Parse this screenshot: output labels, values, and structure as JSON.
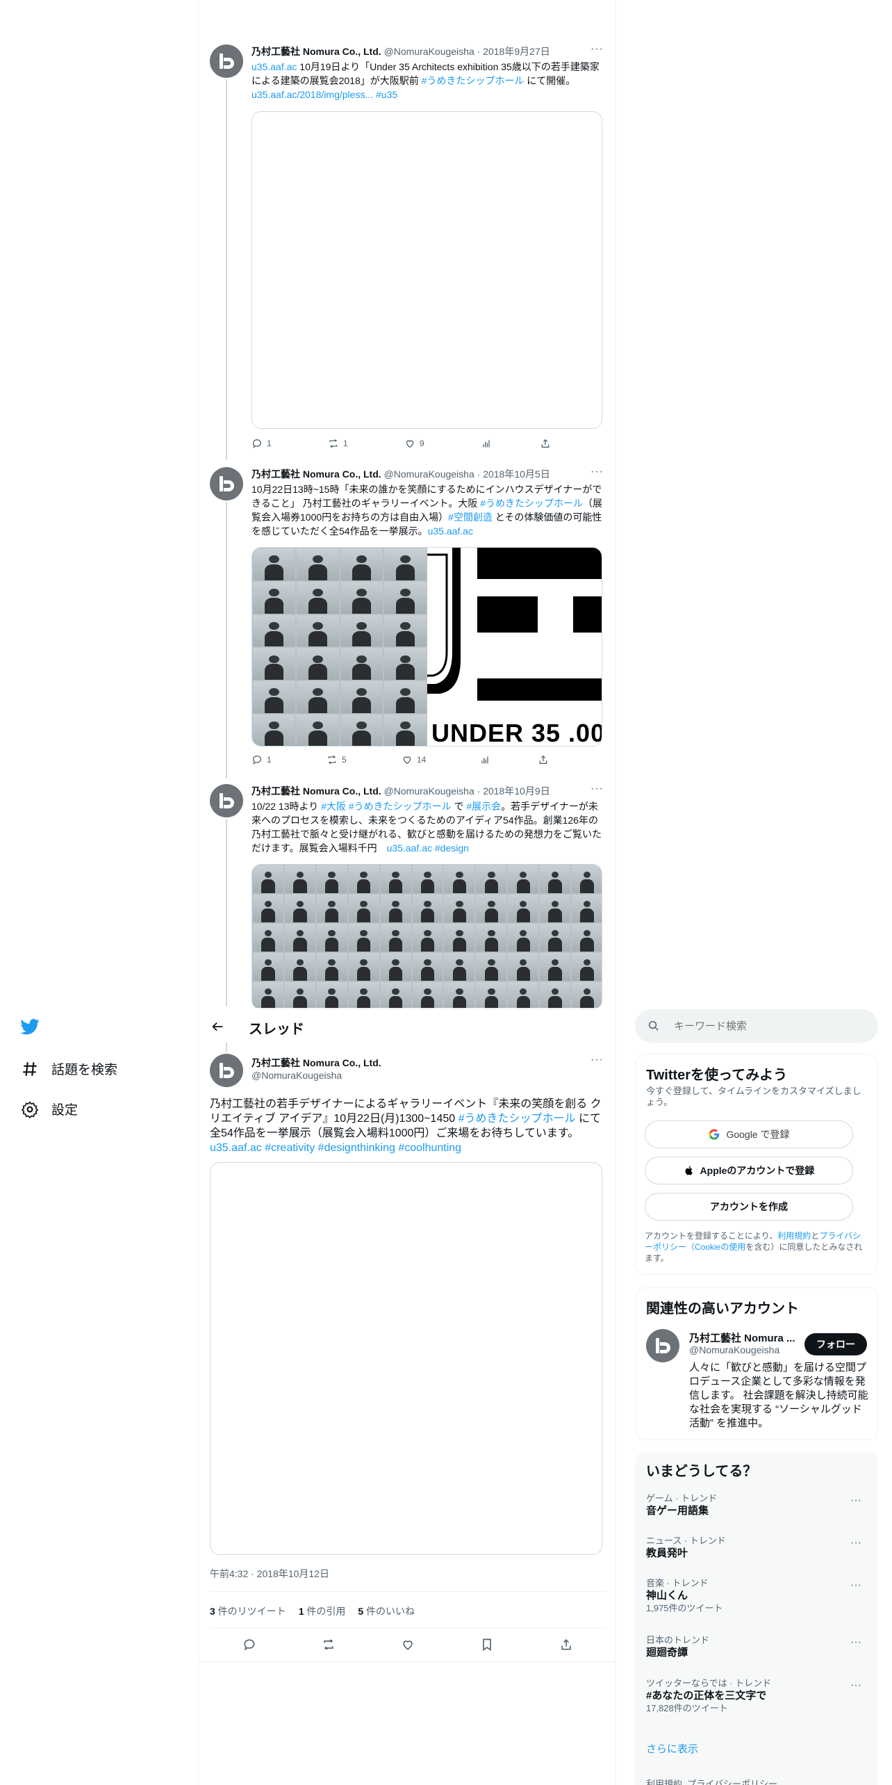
{
  "tweets": [
    {
      "name": "乃村工藝社 Nomura Co., Ltd.",
      "handle": "@NomuraKougeisha",
      "sep": "·",
      "date": "2018年9月27日",
      "more": "···",
      "text": [
        {
          "t": "u35.aaf.ac",
          "link": true
        },
        {
          "t": "  10月19日より「Under 35 Architects exhibition 35歳以下の若手建築家による建築の展覧会2018」が大阪駅前 ",
          "link": false
        },
        {
          "t": "#うめきたシップホール",
          "link": true
        },
        {
          "t": " にて開催。",
          "link": false
        },
        {
          "t": "u35.aaf.ac/2018/img/pless...",
          "link": true
        },
        {
          "t": "  ",
          "link": false
        },
        {
          "t": "#u35",
          "link": true
        }
      ],
      "replies": "1",
      "retweets": "1",
      "likes": "9"
    },
    {
      "name": "乃村工藝社 Nomura Co., Ltd.",
      "handle": "@NomuraKougeisha",
      "sep": "·",
      "date": "2018年10月5日",
      "more": "···",
      "text": [
        {
          "t": "10月22日13時~15時「未来の誰かを笑顔にするためにインハウスデザイナーができること」 乃村工藝社のギャラリーイベント。大阪 ",
          "link": false
        },
        {
          "t": "#うめきたシップホール",
          "link": true
        },
        {
          "t": "（展覧会入場券1000円をお持ちの方は自由入場）",
          "link": false
        },
        {
          "t": "#空間創造",
          "link": true
        },
        {
          "t": " とその体験価値の可能性を感じていただく全54作品を一挙展示。",
          "link": false
        },
        {
          "t": "u35.aaf.ac",
          "link": true
        }
      ],
      "image_caption": "UNDER 35 .00",
      "replies": "1",
      "retweets": "5",
      "likes": "14"
    },
    {
      "name": "乃村工藝社 Nomura Co., Ltd.",
      "handle": "@NomuraKougeisha",
      "sep": "·",
      "date": "2018年10月9日",
      "more": "···",
      "text": [
        {
          "t": "10/22 13時より ",
          "link": false
        },
        {
          "t": "#大阪",
          "link": true
        },
        {
          "t": " ",
          "link": false
        },
        {
          "t": "#うめきたシップホール",
          "link": true
        },
        {
          "t": " で ",
          "link": false
        },
        {
          "t": "#展示会",
          "link": true
        },
        {
          "t": "。若手デザイナーが未来へのプロセスを模索し、未来をつくるためのアイディア54作品。創業126年の乃村工藝社で脈々と受け継がれる、歓びと感動を届けるための発想力をご覧いただけます。展覧会入場料千円　",
          "link": false
        },
        {
          "t": "u35.aaf.ac",
          "link": true
        },
        {
          "t": "  ",
          "link": false
        },
        {
          "t": "#design",
          "link": true
        }
      ]
    }
  ],
  "thread": {
    "title": "スレッド",
    "name": "乃村工藝社 Nomura Co., Ltd.",
    "handle": "@NomuraKougeisha",
    "more": "···",
    "text": [
      {
        "t": "乃村工藝社の若手デザイナーによるギャラリーイベント『未来の笑顔を創る クリエイティブ アイデア』10月22日(月)1300~1450 ",
        "link": false
      },
      {
        "t": "#うめきたシップホール",
        "link": true
      },
      {
        "t": " にて全54作品を一挙展示（展覧会入場料1000円）ご来場をお待ちしています。",
        "link": false
      },
      {
        "t": "u35.aaf.ac",
        "link": true
      },
      {
        "t": "  ",
        "link": false
      },
      {
        "t": "#creativity",
        "link": true
      },
      {
        "t": " ",
        "link": false
      },
      {
        "t": "#designthinking",
        "link": true
      },
      {
        "t": " ",
        "link": false
      },
      {
        "t": "#coolhunting",
        "link": true
      }
    ],
    "timestamp": "午前4:32 · 2018年10月12日",
    "retweets_num": "3",
    "retweets_label": " 件のリツイート",
    "quotes_num": "1",
    "quotes_label": " 件の引用",
    "likes_num": "5",
    "likes_label": " 件のいいね"
  },
  "nav": {
    "explore": "話題を検索",
    "settings": "設定"
  },
  "search": {
    "placeholder": "キーワード検索"
  },
  "signup": {
    "title": "Twitterを使ってみよう",
    "subtitle": "今すぐ登録して、タイムラインをカスタマイズしましょう。",
    "google": "Google で登録",
    "apple": "Appleのアカウントで登録",
    "create": "アカウントを作成",
    "legal_pre": "アカウントを登録することにより、",
    "legal_link1": "利用規約",
    "legal_mid": "と",
    "legal_link2": "プライバシーポリシー（Cookieの使用",
    "legal_post": "を含む）に同意したとみなされます。"
  },
  "related": {
    "title": "関連性の高いアカウント",
    "name": "乃村工藝社 Nomura ...",
    "handle": "@NomuraKougeisha",
    "follow": "フォロー",
    "bio": "人々に「歓びと感動」を届ける空間プロデュース企業として多彩な情報を発信します。 社会課題を解決し持続可能な社会を実現する “ソーシャルグッド活動” を推進中。"
  },
  "trends": {
    "title": "いまどうしてる？",
    "items": [
      {
        "category": "ゲーム · トレンド",
        "title": "音ゲー用語集",
        "count": ""
      },
      {
        "category": "ニュース · トレンド",
        "title": "教員発叶",
        "count": ""
      },
      {
        "category": "音楽 · トレンド",
        "title": "神山くん",
        "count": "1,975件のツイート"
      },
      {
        "category": "日本のトレンド",
        "title": "廻廻奇譚",
        "count": ""
      },
      {
        "category": "ツイッターならでは · トレンド",
        "title": "#あなたの正体を三文字で",
        "count": "17,828件のツイート"
      }
    ],
    "more": "さらに表示",
    "footer": "利用規約  プライバシーポリシー"
  },
  "colors": {
    "accent": "#1d9bf0",
    "text": "#0f1419",
    "muted": "#536471",
    "border": "#cfd9de"
  }
}
